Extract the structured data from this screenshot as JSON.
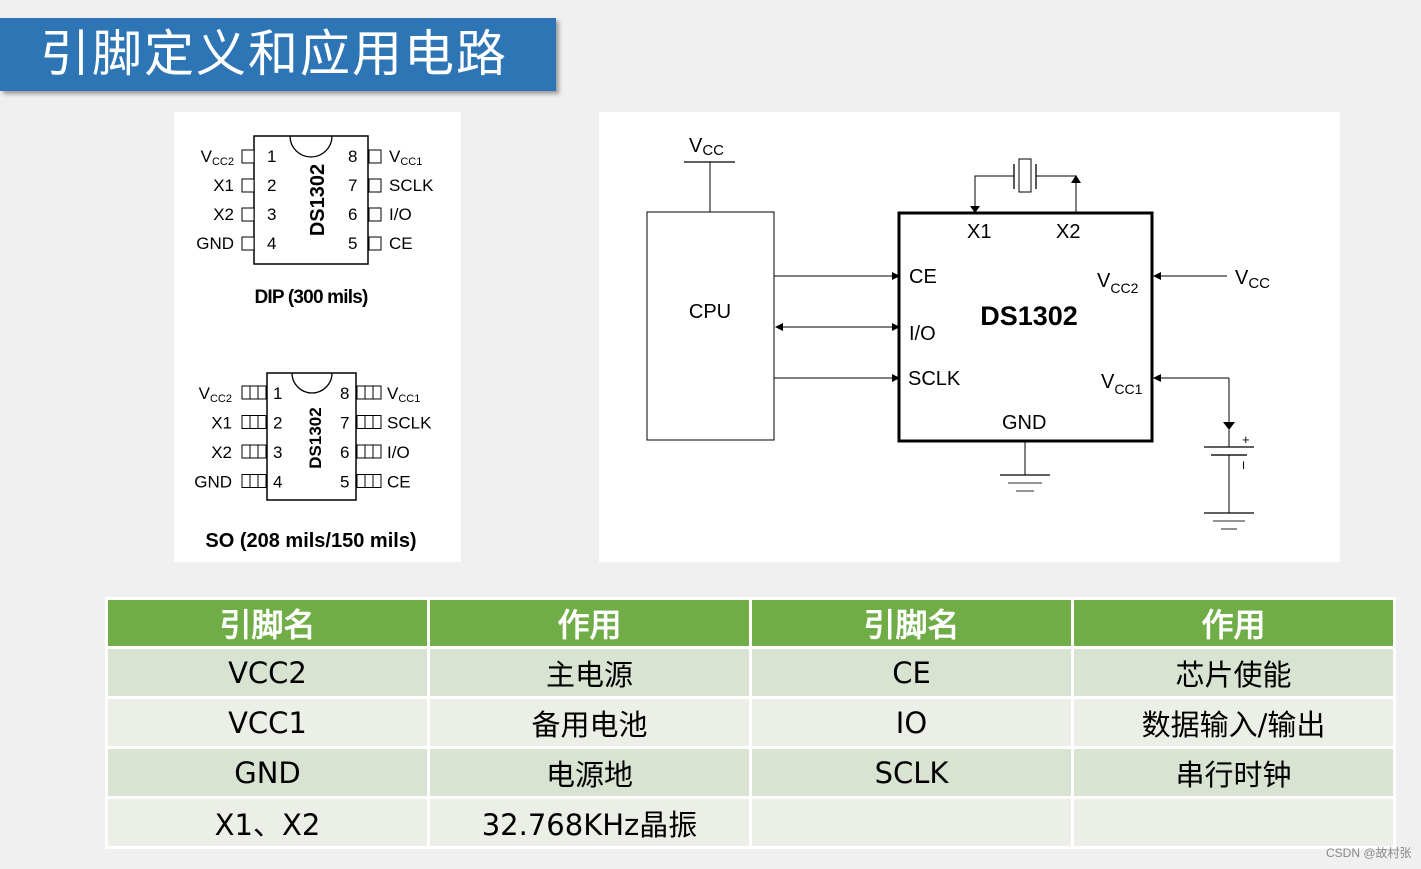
{
  "slide": {
    "title": "引脚定义和应用电路",
    "watermark": "CSDN @故村张"
  },
  "colors": {
    "title_bg": "#2e75b6",
    "table_header": "#70ad47",
    "row_odd": "#d9e3d2",
    "row_even": "#ebefe8"
  },
  "dip": {
    "chip_label": "DS1302",
    "caption": "DIP (300 mils)",
    "left_pins": [
      {
        "num": "1",
        "name": "V",
        "sub": "CC2"
      },
      {
        "num": "2",
        "name": "X1",
        "sub": ""
      },
      {
        "num": "3",
        "name": "X2",
        "sub": ""
      },
      {
        "num": "4",
        "name": "GND",
        "sub": ""
      }
    ],
    "right_pins": [
      {
        "num": "8",
        "name": "V",
        "sub": "CC1"
      },
      {
        "num": "7",
        "name": "SCLK",
        "sub": ""
      },
      {
        "num": "6",
        "name": "I/O",
        "sub": ""
      },
      {
        "num": "5",
        "name": "CE",
        "sub": ""
      }
    ]
  },
  "so": {
    "chip_label": "DS1302",
    "caption": "SO (208 mils/150 mils)",
    "left_pins": [
      {
        "num": "1",
        "name": "V",
        "sub": "CC2"
      },
      {
        "num": "2",
        "name": "X1",
        "sub": ""
      },
      {
        "num": "3",
        "name": "X2",
        "sub": ""
      },
      {
        "num": "4",
        "name": "GND",
        "sub": ""
      }
    ],
    "right_pins": [
      {
        "num": "8",
        "name": "V",
        "sub": "CC1"
      },
      {
        "num": "7",
        "name": "SCLK",
        "sub": ""
      },
      {
        "num": "6",
        "name": "I/O",
        "sub": ""
      },
      {
        "num": "5",
        "name": "CE",
        "sub": ""
      }
    ]
  },
  "circuit": {
    "cpu_label": "CPU",
    "cpu_vcc": {
      "name": "V",
      "sub": "CC"
    },
    "chip_label": "DS1302",
    "pin_x1": "X1",
    "pin_x2": "X2",
    "pin_ce": "CE",
    "pin_io": "I/O",
    "pin_sclk": "SCLK",
    "pin_gnd": "GND",
    "pin_vcc2": {
      "name": "V",
      "sub": "CC2"
    },
    "pin_vcc1": {
      "name": "V",
      "sub": "CC1"
    },
    "ext_vcc": {
      "name": "V",
      "sub": "CC"
    },
    "battery_plus": "+",
    "battery_minus": "I"
  },
  "table": {
    "headers": [
      "引脚名",
      "作用",
      "引脚名",
      "作用"
    ],
    "rows": [
      [
        "VCC2",
        "主电源",
        "CE",
        "芯片使能"
      ],
      [
        "VCC1",
        "备用电池",
        "IO",
        "数据输入/输出"
      ],
      [
        "GND",
        "电源地",
        "SCLK",
        "串行时钟"
      ],
      [
        "X1、X2",
        "32.768KHz晶振",
        "",
        ""
      ]
    ]
  }
}
